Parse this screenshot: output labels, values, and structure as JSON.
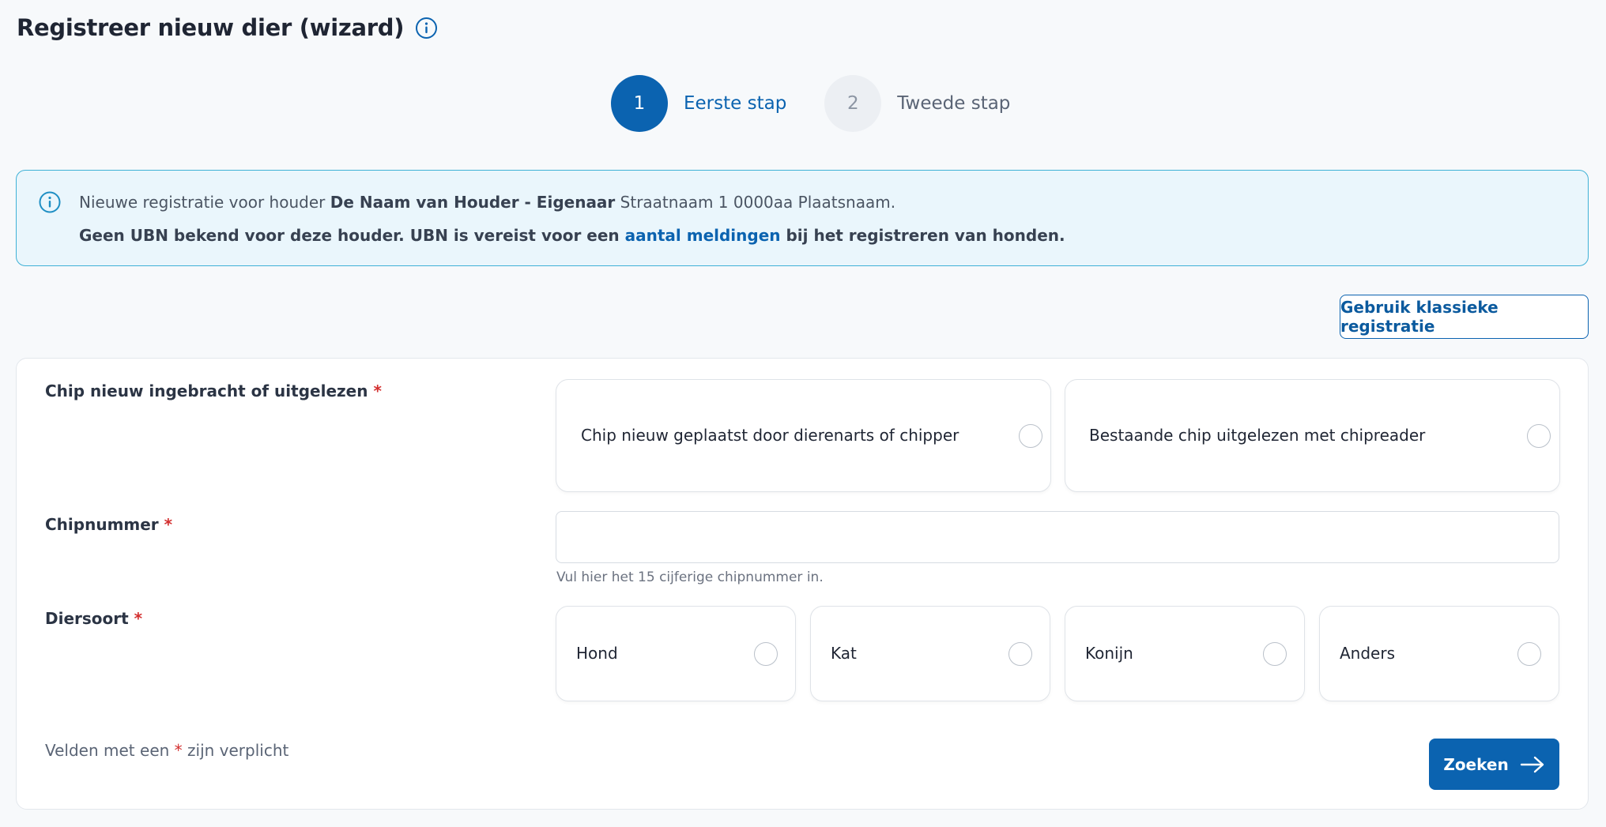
{
  "page": {
    "title": "Registreer nieuw dier (wizard)"
  },
  "stepper": {
    "steps": [
      {
        "number": "1",
        "label": "Eerste stap",
        "state": "active"
      },
      {
        "number": "2",
        "label": "Tweede stap",
        "state": "inactive"
      }
    ]
  },
  "alert": {
    "line1_prefix": "Nieuwe registratie voor houder ",
    "holder_name": "De Naam van Houder - Eigenaar",
    "address": " Straatnaam 1 0000aa Plaatsnaam.",
    "line2_before": "Geen UBN bekend voor deze houder. UBN is vereist voor een ",
    "line2_link": "aantal meldingen",
    "line2_after": " bij het registreren van honden."
  },
  "actions": {
    "classic_label": "Gebruik klassieke registratie",
    "search_label": "Zoeken"
  },
  "form": {
    "chip_source": {
      "label": "Chip nieuw ingebracht of uitgelezen",
      "required_mark": "*",
      "options": [
        "Chip nieuw geplaatst door dierenarts of chipper",
        "Bestaande chip uitgelezen met chipreader"
      ]
    },
    "chipnumber": {
      "label": "Chipnummer",
      "required_mark": "*",
      "value": "",
      "helper": "Vul hier het 15 cijferige chipnummer in."
    },
    "species": {
      "label": "Diersoort",
      "required_mark": "*",
      "options": [
        "Hond",
        "Kat",
        "Konijn",
        "Anders"
      ]
    },
    "required_note": {
      "before": "Velden met een ",
      "mark": "*",
      "after": " zijn verplicht"
    }
  },
  "colors": {
    "primary": "#0b63b0",
    "alert_bg": "#eaf6fc",
    "alert_border": "#3fb1d6",
    "required": "#d32f2f"
  },
  "icons": {
    "title_info": "info-icon",
    "alert_info": "info-icon",
    "search_arrow": "arrow-right-icon"
  }
}
